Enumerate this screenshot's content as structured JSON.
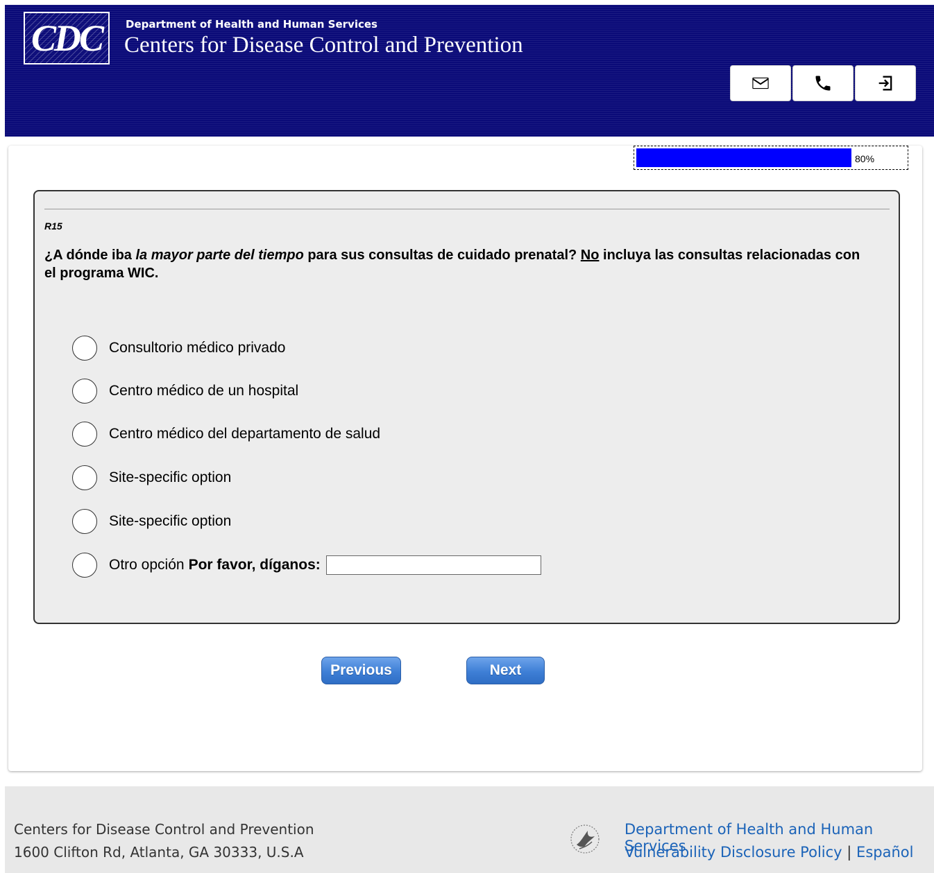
{
  "header": {
    "logo_text": "CDC",
    "department": "Department of Health and Human Services",
    "agency": "Centers for Disease Control and Prevention",
    "buttons": [
      {
        "icon": "mail-icon"
      },
      {
        "icon": "phone-icon"
      },
      {
        "icon": "exit-icon"
      }
    ]
  },
  "progress": {
    "value": 0.8,
    "label": "80%",
    "color": "#0000ff"
  },
  "question": {
    "code": "R15",
    "text_part1": "¿A dónde iba ",
    "text_emphasis": "la mayor parte del tiempo",
    "text_part2": " para sus consultas de cuidado prenatal? ",
    "text_underline": "No",
    "text_part3": " incluya las consultas relacionadas con el programa WIC.",
    "options": [
      {
        "label": "Consultorio médico privado"
      },
      {
        "label": "Centro médico de un hospital"
      },
      {
        "label": "Centro médico del departamento de salud"
      },
      {
        "label": "Site-specific option"
      },
      {
        "label": "Site-specific option"
      },
      {
        "label": "Otro opción",
        "prompt": "Por favor, díganos:",
        "input_value": ""
      }
    ]
  },
  "nav": {
    "previous": "Previous",
    "next": "Next"
  },
  "footer": {
    "org": "Centers for Disease Control and Prevention",
    "address": "1600 Clifton Rd, Atlanta, GA 30333, U.S.A",
    "hhs_link": "Department of Health and Human Services",
    "vdp_link": "Vulnerability Disclosure Policy",
    "separator": "|",
    "espanol_link": "Español"
  },
  "colors": {
    "header_bg": "#0a0a78",
    "button_blue": "#3e7fd6",
    "link_blue": "#1b63b8"
  }
}
